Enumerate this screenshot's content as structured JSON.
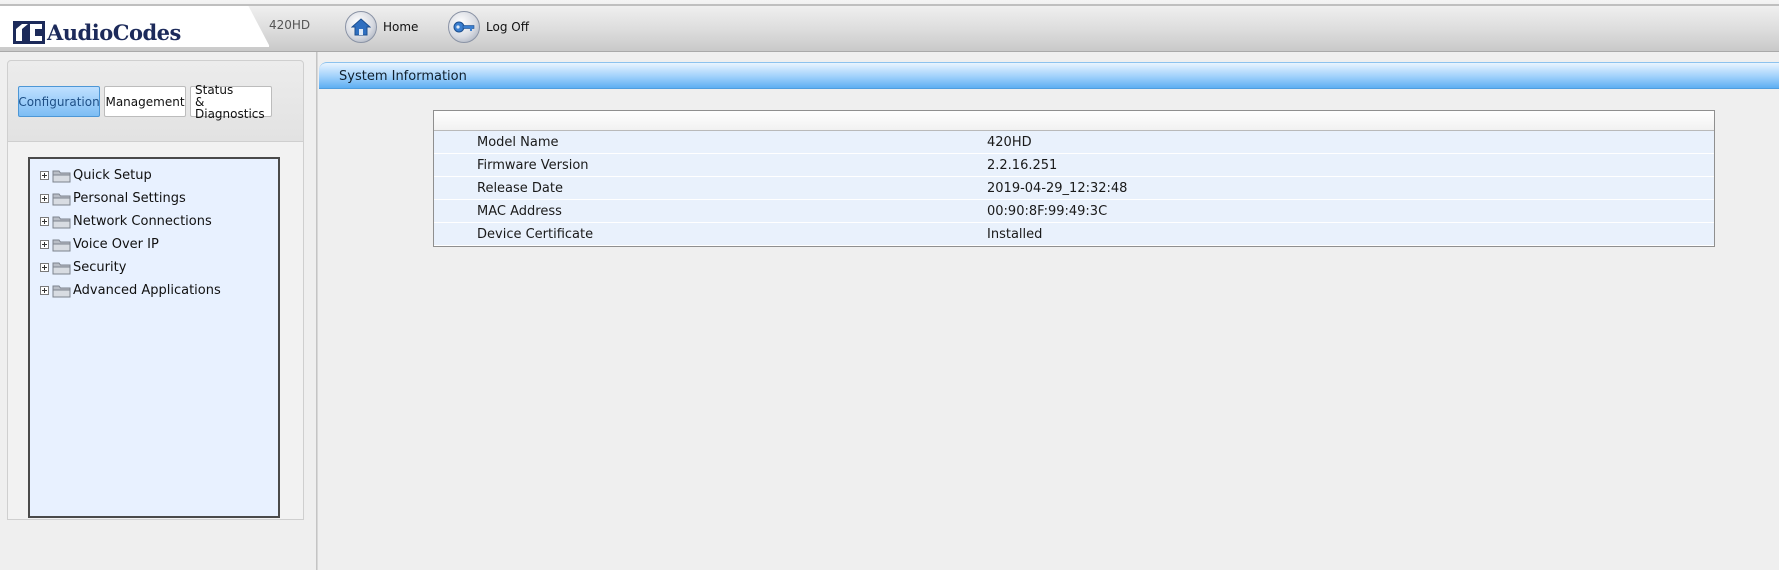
{
  "header": {
    "brand": "AudioCodes",
    "model": "420HD",
    "nav": [
      {
        "label": "Home",
        "icon": "home-icon"
      },
      {
        "label": "Log Off",
        "icon": "key-icon"
      }
    ]
  },
  "tabs": [
    {
      "label": "Configuration",
      "active": true
    },
    {
      "label": "Management",
      "active": false
    },
    {
      "label_line1": "Status",
      "label_line2": "& Diagnostics",
      "active": false
    }
  ],
  "tree": {
    "items": [
      {
        "label": "Quick Setup"
      },
      {
        "label": "Personal Settings"
      },
      {
        "label": "Network Connections"
      },
      {
        "label": "Voice Over IP"
      },
      {
        "label": "Security"
      },
      {
        "label": "Advanced Applications"
      }
    ]
  },
  "main": {
    "section_title": "System Information",
    "rows": [
      {
        "label": "Model Name",
        "value": "420HD"
      },
      {
        "label": "Firmware Version",
        "value": "2.2.16.251"
      },
      {
        "label": "Release Date",
        "value": "2019-04-29_12:32:48"
      },
      {
        "label": "MAC Address",
        "value": "00:90:8F:99:49:3C"
      },
      {
        "label": "Device Certificate",
        "value": "Installed"
      }
    ]
  },
  "colors": {
    "accent_blue": "#5eaef2",
    "tree_bg": "#e8f1ff",
    "row_bg": "#e9f1fc",
    "brand_navy": "#1c2a5a"
  }
}
